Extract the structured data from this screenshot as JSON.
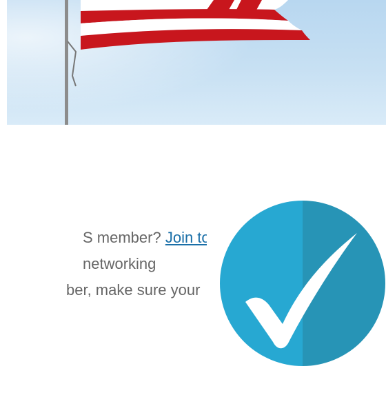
{
  "hero": {
    "image": "american-flag-on-pole",
    "colors": {
      "sky": "#c7e0f3",
      "stripe_red": "#c8161d",
      "stripe_white": "#ffffff",
      "pole": "#8c8c8c"
    }
  },
  "membership": {
    "line1_text": "S member? ",
    "join_link": "Join today",
    "line2_text": "networking",
    "line3_text": "ber, make sure your"
  },
  "badge": {
    "icon": "checkmark-icon",
    "colors": {
      "circle_light": "#27a8d2",
      "circle_dark": "#2794b6",
      "check": "#ffffff"
    }
  }
}
